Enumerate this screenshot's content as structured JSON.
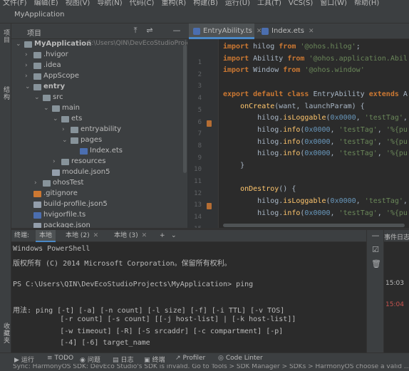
{
  "menubar": {
    "items": [
      "文件(F)",
      "编辑(E)",
      "视图(V)",
      "导航(N)",
      "代码(C)",
      "重构(R)",
      "构建(B)",
      "运行(U)",
      "工具(T)",
      "VCS(S)",
      "窗口(W)",
      "帮助(H)"
    ]
  },
  "titlebar": {
    "project_name": "MyApplication"
  },
  "left_strip": {
    "project_tab": "项目",
    "structure_tab": "结构",
    "favorites_tab": "收藏夹"
  },
  "project_panel": {
    "header": "项目",
    "tree": [
      {
        "label": "MyApplication",
        "path": "C:\\Users\\QIN\\DevEcoStudioProje",
        "kind": "folder",
        "expanded": true
      },
      {
        "label": ".hvigor",
        "kind": "folder"
      },
      {
        "label": ".idea",
        "kind": "folder"
      },
      {
        "label": "AppScope",
        "kind": "folder"
      },
      {
        "label": "entry",
        "kind": "folder",
        "expanded": true
      },
      {
        "label": "src",
        "kind": "folder",
        "expanded": true
      },
      {
        "label": "main",
        "kind": "folder",
        "expanded": true
      },
      {
        "label": "ets",
        "kind": "folder",
        "expanded": true
      },
      {
        "label": "entryability",
        "kind": "folder"
      },
      {
        "label": "pages",
        "kind": "folder",
        "expanded": true
      },
      {
        "label": "Index.ets",
        "kind": "ts"
      },
      {
        "label": "resources",
        "kind": "folder"
      },
      {
        "label": "module.json5",
        "kind": "json"
      },
      {
        "label": "ohosTest",
        "kind": "folder"
      },
      {
        "label": ".gitignore",
        "kind": "git"
      },
      {
        "label": "build-profile.json5",
        "kind": "json"
      },
      {
        "label": "hvigorfile.ts",
        "kind": "ts"
      },
      {
        "label": "package.json",
        "kind": "json"
      }
    ]
  },
  "editor": {
    "tabs": [
      {
        "label": "EntryAbility.ts",
        "active": true
      },
      {
        "label": "Index.ets",
        "active": false
      }
    ],
    "line_numbers": [
      "1",
      "2",
      "3",
      "4",
      "5",
      "6",
      "7",
      "8",
      "9",
      "10",
      "11",
      "12",
      "13",
      "14",
      "15"
    ],
    "code_lines": [
      {
        "n": 1,
        "html": "<span class=\"kw\">import</span> hilog <span class=\"kw\">from</span> <span class=\"str\">'@ohos.hilog'</span>;"
      },
      {
        "n": 2,
        "html": "<span class=\"kw\">import</span> Ability <span class=\"kw\">from</span> <span class=\"str\">'@ohos.application.Abil</span>"
      },
      {
        "n": 3,
        "html": "<span class=\"kw\">import</span> Window <span class=\"kw\">from</span> <span class=\"str\">'@ohos.window'</span>"
      },
      {
        "n": 4,
        "html": ""
      },
      {
        "n": 5,
        "html": "<span class=\"kw\">export default class</span> EntryAbility <span class=\"kw\">extends</span> A"
      },
      {
        "n": 6,
        "html": "    <span class=\"fn\">onCreate</span>(want, launchParam) {"
      },
      {
        "n": 7,
        "html": "        hilog.<span class=\"fn\">isLoggable</span>(<span class=\"num\">0x0000</span>, <span class=\"str\">'testTag'</span>,"
      },
      {
        "n": 8,
        "html": "        hilog.<span class=\"fn\">info</span>(<span class=\"num\">0x0000</span>, <span class=\"str\">'testTag'</span>, <span class=\"str\">'%{pu</span>"
      },
      {
        "n": 9,
        "html": "        hilog.<span class=\"fn\">info</span>(<span class=\"num\">0x0000</span>, <span class=\"str\">'testTag'</span>, <span class=\"str\">'%{pu</span>"
      },
      {
        "n": 10,
        "html": "        hilog.<span class=\"fn\">info</span>(<span class=\"num\">0x0000</span>, <span class=\"str\">'testTag'</span>, <span class=\"str\">'%{pu</span>"
      },
      {
        "n": 11,
        "html": "    }"
      },
      {
        "n": 12,
        "html": ""
      },
      {
        "n": 13,
        "html": "    <span class=\"fn\">onDestroy</span>() {"
      },
      {
        "n": 14,
        "html": "        hilog.<span class=\"fn\">isLoggable</span>(<span class=\"num\">0x0000</span>, <span class=\"str\">'testTag'</span>,"
      },
      {
        "n": 15,
        "html": "        hilog.<span class=\"fn\">info</span>(<span class=\"num\">0x0000</span>, <span class=\"str\">'testTag'</span>, <span class=\"str\">'%{pu</span>"
      }
    ]
  },
  "terminal": {
    "label": "终端:",
    "tabs": [
      {
        "label": "本地",
        "active": true,
        "closable": false
      },
      {
        "label": "本地 (2)",
        "active": false,
        "closable": true
      },
      {
        "label": "本地 (3)",
        "active": false,
        "closable": true
      }
    ],
    "add_label": "+",
    "more_label": "⌄",
    "lines": [
      "Windows PowerShell",
      "版权所有 (C) 2014 Microsoft Corporation。保留所有权利。",
      "",
      "PS C:\\Users\\QIN\\DevEcoStudioProjects\\MyApplication> ping",
      "",
      "用法: ping [-t] [-a] [-n count] [-l size] [-f] [-i TTL] [-v TOS]",
      "           [-r count] [-s count] [[-j host-list] | [-k host-list]]",
      "           [-w timeout] [-R] [-S srcaddr] [-c compartment] [-p]",
      "           [-4] [-6] target_name"
    ]
  },
  "event_log": {
    "title": "事件日志",
    "times": [
      {
        "time": "15:03",
        "color": "#bbbbbb"
      },
      {
        "time": "15:04",
        "color": "#c75450"
      }
    ]
  },
  "bottom_tools": [
    {
      "label": "运行",
      "icon": "▶"
    },
    {
      "label": "TODO",
      "icon": "≡"
    },
    {
      "label": "问题",
      "icon": "◉"
    },
    {
      "label": "日志",
      "icon": "▤"
    },
    {
      "label": "终端",
      "icon": "▣"
    },
    {
      "label": "Profiler",
      "icon": "↗"
    },
    {
      "label": "Code Linter",
      "icon": "◎"
    }
  ],
  "status": {
    "message": "Sync: HarmonyOS SDK: DevEco Studio's SDK is invalid. Go to Tools > SDK Manager > SDKs > HarmonyOS choose a valid ... (4"
  }
}
